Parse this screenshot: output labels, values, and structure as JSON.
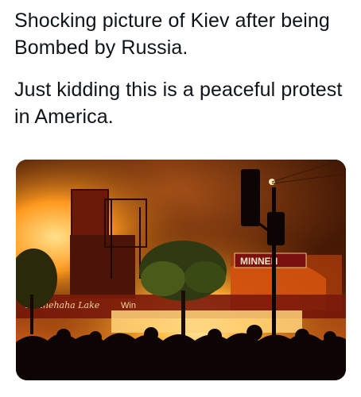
{
  "tweet": {
    "paragraph_1": "Shocking picture of Kiev after being Bombed by Russia.",
    "paragraph_2": "Just kidding this is a peaceful protest in America."
  },
  "photo": {
    "signs": {
      "minnehaha_sign": "MINNEH",
      "lake_sign": "Minnehaha Lake",
      "wine_sign": "Win"
    },
    "colors": {
      "fire": "#ff9a1f",
      "smoke": "#5a2608",
      "sky": "#2a0d02",
      "silhouette": "#0d0503"
    }
  }
}
